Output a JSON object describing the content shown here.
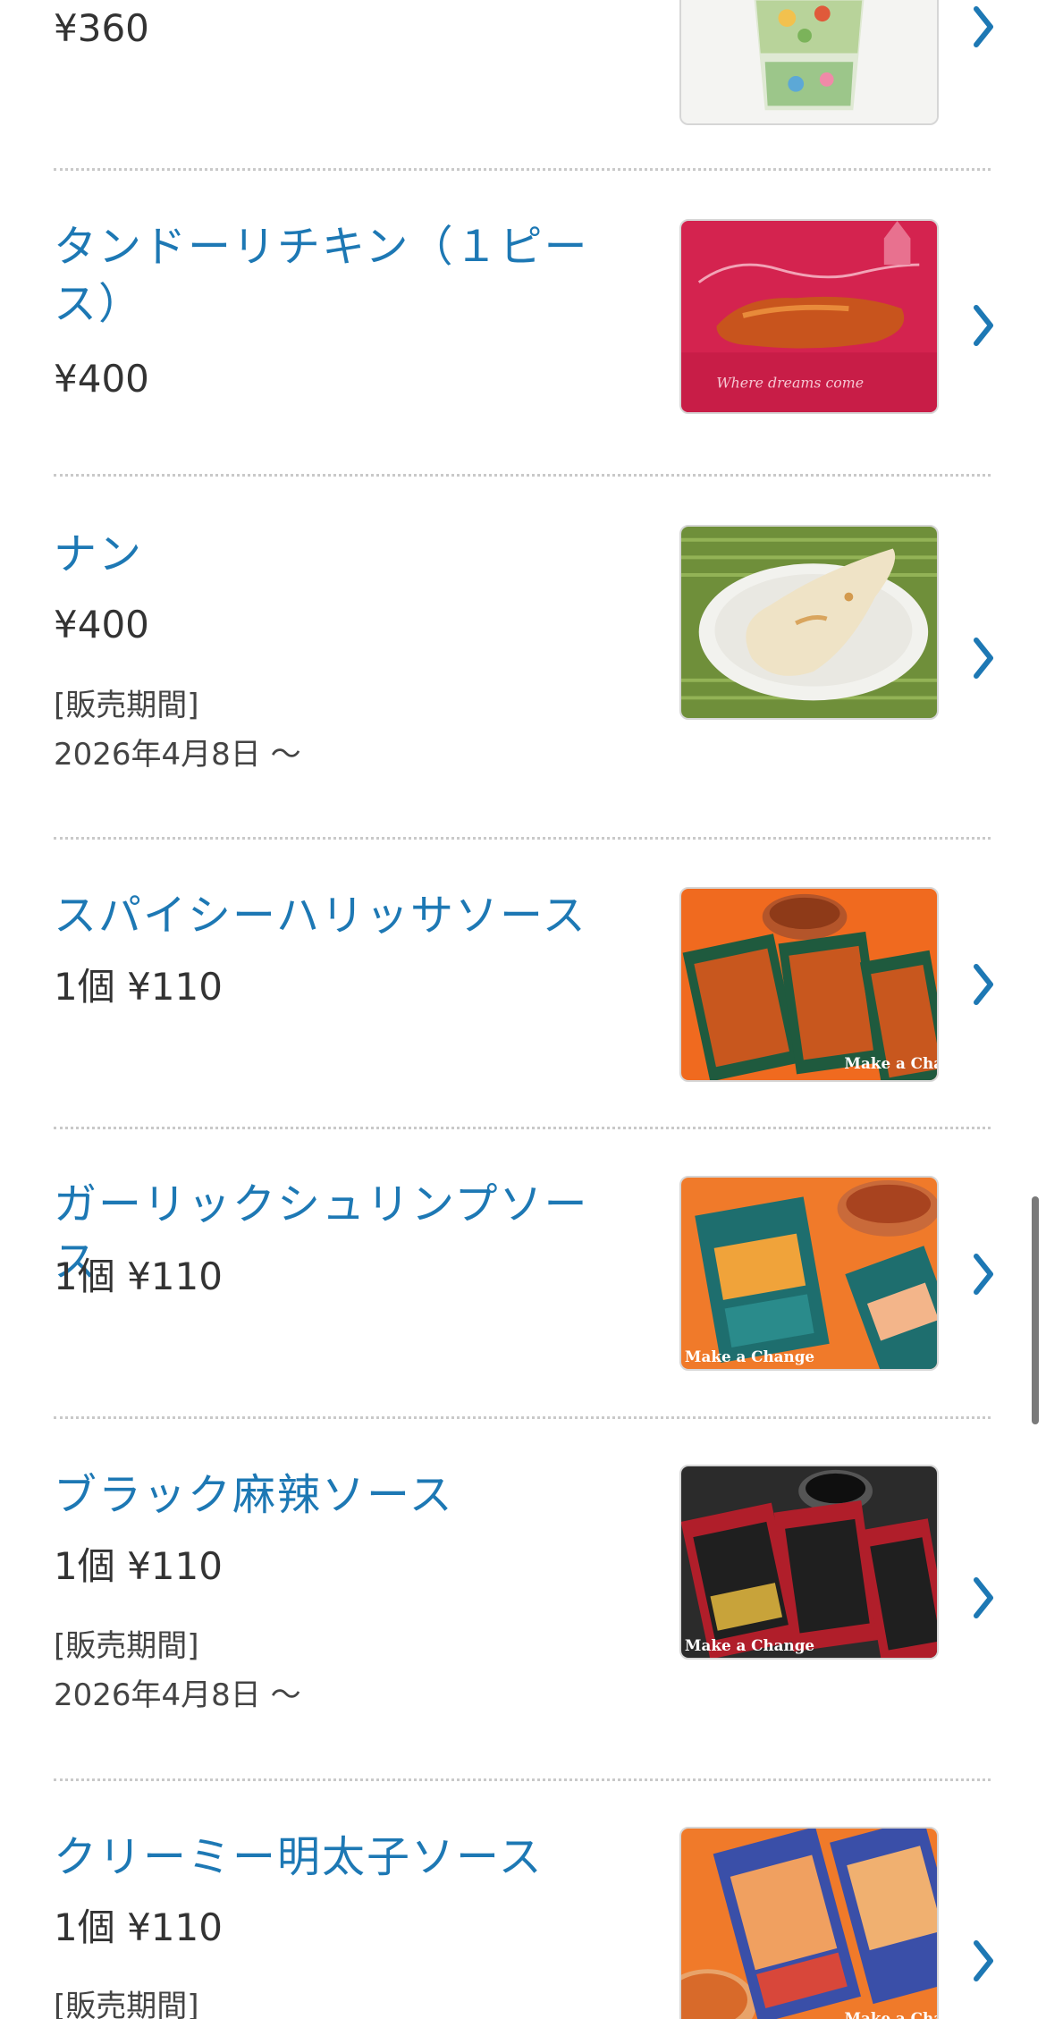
{
  "items": [
    {
      "name": "",
      "price": "¥360",
      "period_label": "",
      "period_date": "",
      "image": "salad-cup"
    },
    {
      "name": "タンドーリチキン（１ピース）",
      "price": "¥400",
      "period_label": "",
      "period_date": "",
      "image": "tandoori-chicken"
    },
    {
      "name": "ナン",
      "price": "¥400",
      "period_label": "[販売期間]",
      "period_date": "2026年4月8日 ～",
      "image": "naan"
    },
    {
      "name": "スパイシーハリッサソース",
      "price": "1個 ¥110",
      "period_label": "",
      "period_date": "",
      "image": "harissa-sauce-packets"
    },
    {
      "name": "ガーリックシュリンプソース",
      "price": "1個 ¥110",
      "period_label": "",
      "period_date": "",
      "image": "garlic-shrimp-sauce-packets"
    },
    {
      "name": "ブラック麻辣ソース",
      "price": "1個 ¥110",
      "period_label": "[販売期間]",
      "period_date": "2026年4月8日 ～",
      "image": "black-mala-sauce-packets"
    },
    {
      "name": "クリーミー明太子ソース",
      "price": "1個 ¥110",
      "period_label": "[販売期間]",
      "period_date": "",
      "image": "mentaiko-sauce-packets"
    }
  ],
  "thumb_text": {
    "make_a_change": "Make a Change",
    "where_dreams": "Where dreams come"
  },
  "colors": {
    "link_blue": "#1d78b4",
    "chevron_blue": "#1d78b4",
    "text_dark": "#333333",
    "divider": "#c9c9c9"
  },
  "icons": {
    "chevron": "chevron-right-icon"
  }
}
